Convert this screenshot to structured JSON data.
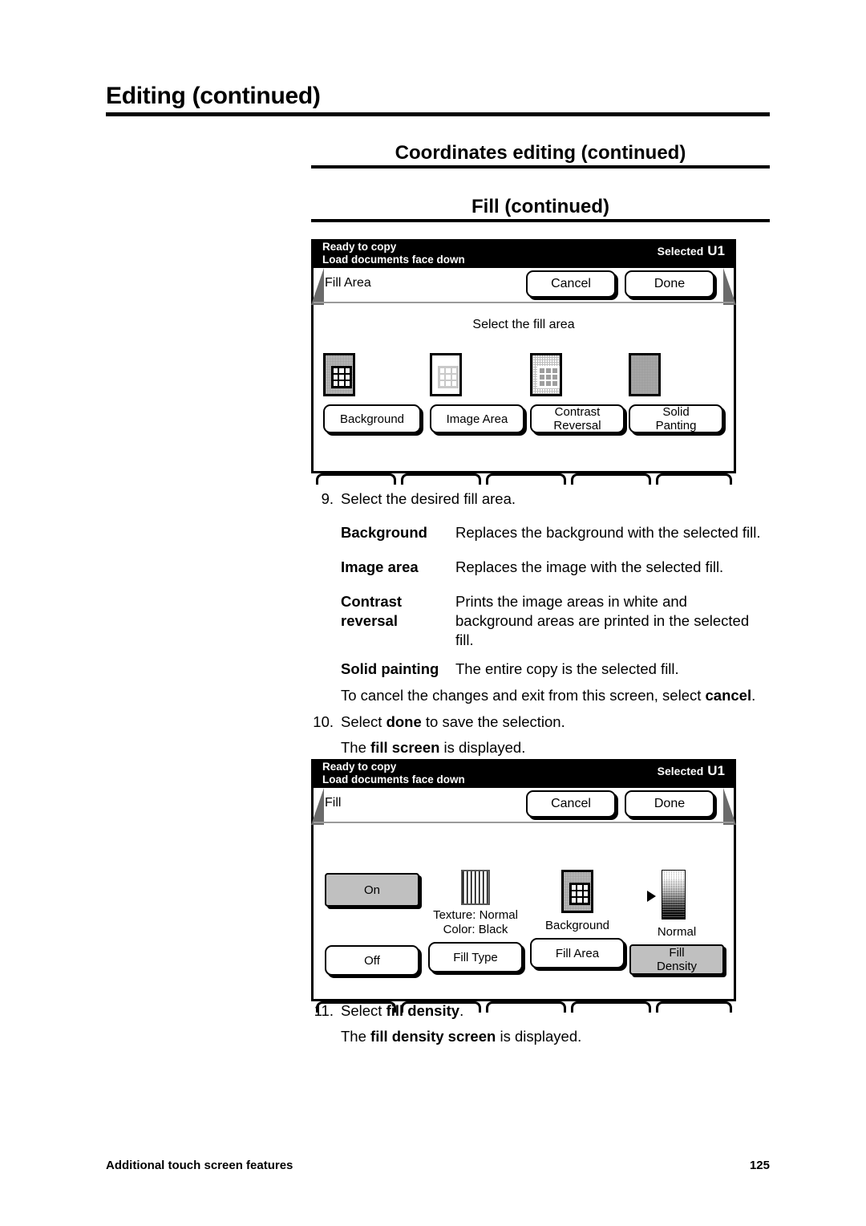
{
  "headings": {
    "h1": "Editing (continued)",
    "h2": "Coordinates editing (continued)",
    "h3": "Fill (continued)"
  },
  "screen1": {
    "status_line1": "Ready to copy",
    "status_line2": "Load documents face down",
    "selected_label": "Selected",
    "selected_value": "U1",
    "dialog_title": "Fill Area",
    "cancel_label": "Cancel",
    "done_label": "Done",
    "hint": "Select the fill area",
    "options": [
      {
        "line1": "Background",
        "line2": "",
        "icon": "background-fill-icon"
      },
      {
        "line1": "Image Area",
        "line2": "",
        "icon": "image-area-fill-icon"
      },
      {
        "line1": "Contrast",
        "line2": "Reversal",
        "icon": "contrast-reversal-icon"
      },
      {
        "line1": "Solid",
        "line2": "Panting",
        "icon": "solid-painting-icon"
      }
    ]
  },
  "screen2": {
    "status_line1": "Ready to copy",
    "status_line2": "Load documents face down",
    "selected_label": "Selected",
    "selected_value": "U1",
    "dialog_title": "Fill",
    "cancel_label": "Cancel",
    "done_label": "Done",
    "on_label": "On",
    "off_label": "Off",
    "texture_line1": "Texture: Normal",
    "texture_line2": "Color: Black",
    "fill_type_label": "Fill Type",
    "fill_area_value": "Background",
    "fill_area_label": "Fill Area",
    "fill_density_value": "Normal",
    "fill_density_line1": "Fill",
    "fill_density_line2": "Density"
  },
  "body": {
    "step9_num": "9.",
    "step9_text": "Select the desired fill area.",
    "defs": [
      {
        "term": "Background",
        "term2": "",
        "desc": "Replaces the background with the selected fill.",
        "desc2": "",
        "desc3": ""
      },
      {
        "term": "Image area",
        "term2": "",
        "desc": "Replaces the image with the selected fill.",
        "desc2": "",
        "desc3": ""
      },
      {
        "term": "Contrast",
        "term2": "reversal",
        "desc": "Prints the image areas in white and",
        "desc2": "background areas are printed in the selected",
        "desc3": "fill."
      },
      {
        "term": "Solid painting",
        "term2": "",
        "desc": "The entire copy is the selected fill.",
        "desc2": "",
        "desc3": ""
      }
    ],
    "cancel_note_pre": "To cancel the changes and exit from this screen, select ",
    "cancel_note_bold": "cancel",
    "cancel_note_post": ".",
    "step10_num": "10.",
    "step10_pre": "Select ",
    "step10_bold": "done",
    "step10_post": " to save the selection.",
    "step10_sub_pre": "The ",
    "step10_sub_bold": "fill screen",
    "step10_sub_post": " is displayed.",
    "step11_num": "11.",
    "step11_pre": "Select ",
    "step11_bold": "fill density",
    "step11_post": ".",
    "step11_sub_pre": "The ",
    "step11_sub_bold": "fill density screen",
    "step11_sub_post": " is displayed."
  },
  "footer": {
    "left": "Additional touch screen features",
    "page": "125"
  }
}
